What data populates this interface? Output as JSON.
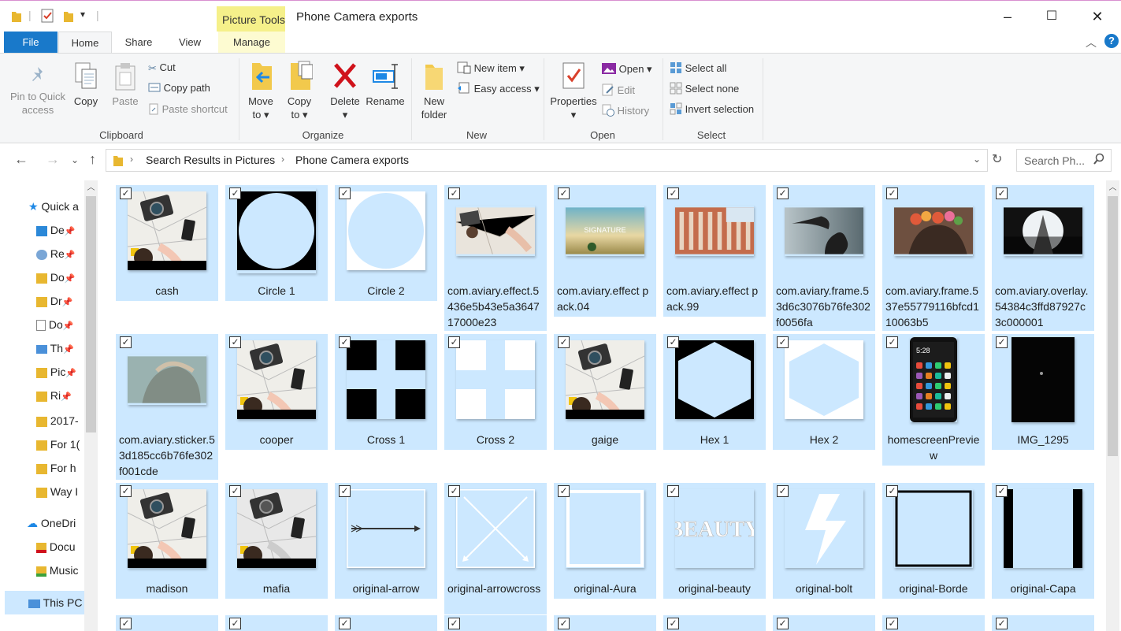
{
  "window": {
    "title": "Phone Camera exports",
    "context_tab": "Picture Tools",
    "controls": {
      "minimize": "–",
      "maximize": "☐",
      "close": "✕"
    }
  },
  "tabs": [
    "File",
    "Home",
    "Share",
    "View",
    "Manage"
  ],
  "ribbon": {
    "clipboard": {
      "label": "Clipboard",
      "pin_line1": "Pin to Quick",
      "pin_line2": "access",
      "copy": "Copy",
      "paste": "Paste",
      "cut": "Cut",
      "copy_path": "Copy path",
      "paste_shortcut": "Paste shortcut"
    },
    "organize": {
      "label": "Organize",
      "move_to_1": "Move",
      "move_to_2": "to",
      "copy_to_1": "Copy",
      "copy_to_2": "to",
      "delete": "Delete",
      "rename": "Rename"
    },
    "new": {
      "label": "New",
      "new_folder_1": "New",
      "new_folder_2": "folder",
      "new_item": "New item",
      "easy_access": "Easy access"
    },
    "open": {
      "label": "Open",
      "properties": "Properties",
      "open": "Open",
      "edit": "Edit",
      "history": "History"
    },
    "select": {
      "label": "Select",
      "select_all": "Select all",
      "select_none": "Select none",
      "invert_selection": "Invert selection"
    }
  },
  "address": {
    "crumb1": "Search Results in Pictures",
    "crumb2": "Phone Camera exports",
    "search_placeholder": "Search Ph..."
  },
  "nav_pane": {
    "items": [
      "Quick a",
      "De",
      "Re",
      "Do",
      "Dr",
      "Do",
      "Th",
      "Pic",
      "Ri",
      "2017-",
      "For 1(",
      "For h",
      "Way I",
      "OneDri",
      "Docu",
      "Music",
      "This PC"
    ]
  },
  "files": [
    {
      "name": "cash",
      "kind": "photo"
    },
    {
      "name": "Circle 1",
      "kind": "circle-black"
    },
    {
      "name": "Circle 2",
      "kind": "circle-white"
    },
    {
      "name": "com.aviary.effect.5436e5b43e5a364717000e23",
      "kind": "wide-map"
    },
    {
      "name": "com.aviary.effect pack.04",
      "kind": "wide-sky"
    },
    {
      "name": "com.aviary.effect pack.99",
      "kind": "wide-building"
    },
    {
      "name": "com.aviary.frame.53d6c3076b76fe302f0056fa",
      "kind": "wide-hair"
    },
    {
      "name": "com.aviary.frame.537e55779116bfcd110063b5",
      "kind": "wide-flowers"
    },
    {
      "name": "com.aviary.overlay.54384c3ffd87927c3c000001",
      "kind": "wide-overlay"
    },
    {
      "name": "com.aviary.sticker.53d185cc6b76fe302f001cde",
      "kind": "wide-girl"
    },
    {
      "name": "cooper",
      "kind": "photo"
    },
    {
      "name": "Cross 1",
      "kind": "cross-black"
    },
    {
      "name": "Cross 2",
      "kind": "cross-white"
    },
    {
      "name": "gaige",
      "kind": "photo"
    },
    {
      "name": "Hex 1",
      "kind": "hex-black"
    },
    {
      "name": "Hex 2",
      "kind": "hex-white"
    },
    {
      "name": "homescreenPreview",
      "kind": "phone"
    },
    {
      "name": "IMG_1295",
      "kind": "dark"
    },
    {
      "name": "madison",
      "kind": "photo"
    },
    {
      "name": "mafia",
      "kind": "photo-bw"
    },
    {
      "name": "original-arrow",
      "kind": "arrow"
    },
    {
      "name": "original-arrowcross",
      "kind": "arrowcross"
    },
    {
      "name": "original-Aura",
      "kind": "aura"
    },
    {
      "name": "original-beauty",
      "kind": "beauty"
    },
    {
      "name": "original-bolt",
      "kind": "bolt"
    },
    {
      "name": "original-Borde",
      "kind": "border"
    },
    {
      "name": "original-Capa",
      "kind": "capa"
    }
  ]
}
